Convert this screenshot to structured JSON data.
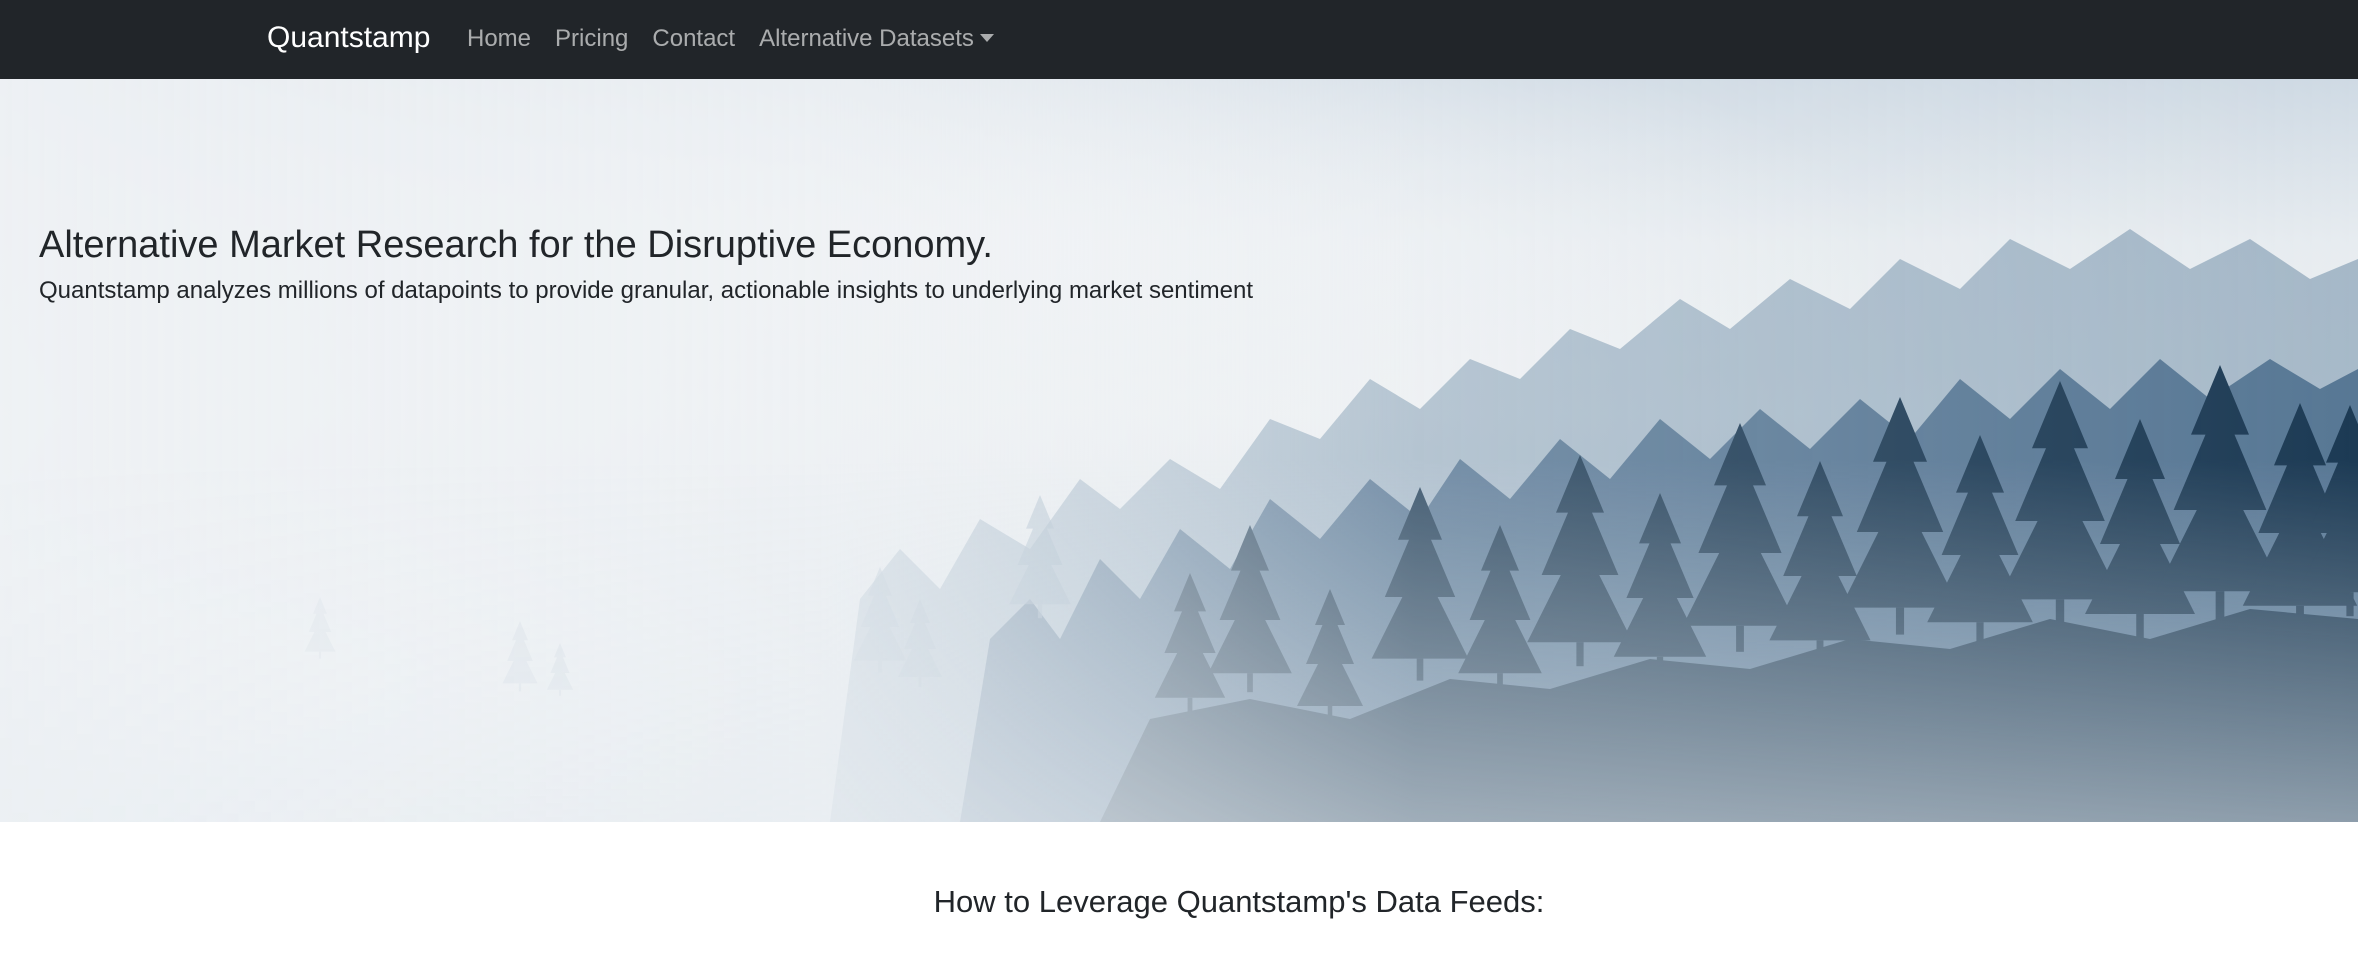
{
  "navbar": {
    "brand": "Quantstamp",
    "links": [
      "Home",
      "Pricing",
      "Contact"
    ],
    "dropdown_label": "Alternative Datasets"
  },
  "hero": {
    "title": "Alternative Market Research for the Disruptive Economy.",
    "subtitle": "Quantstamp analyzes millions of datapoints to provide granular, actionable insights to underlying market sentiment",
    "image": "misty-pine-forest"
  },
  "section": {
    "heading": "How to Leverage Quantstamp's Data Feeds:"
  },
  "colors": {
    "navbar_bg": "#212529",
    "text": "#212529",
    "forest_dark": "#1d3b55"
  }
}
